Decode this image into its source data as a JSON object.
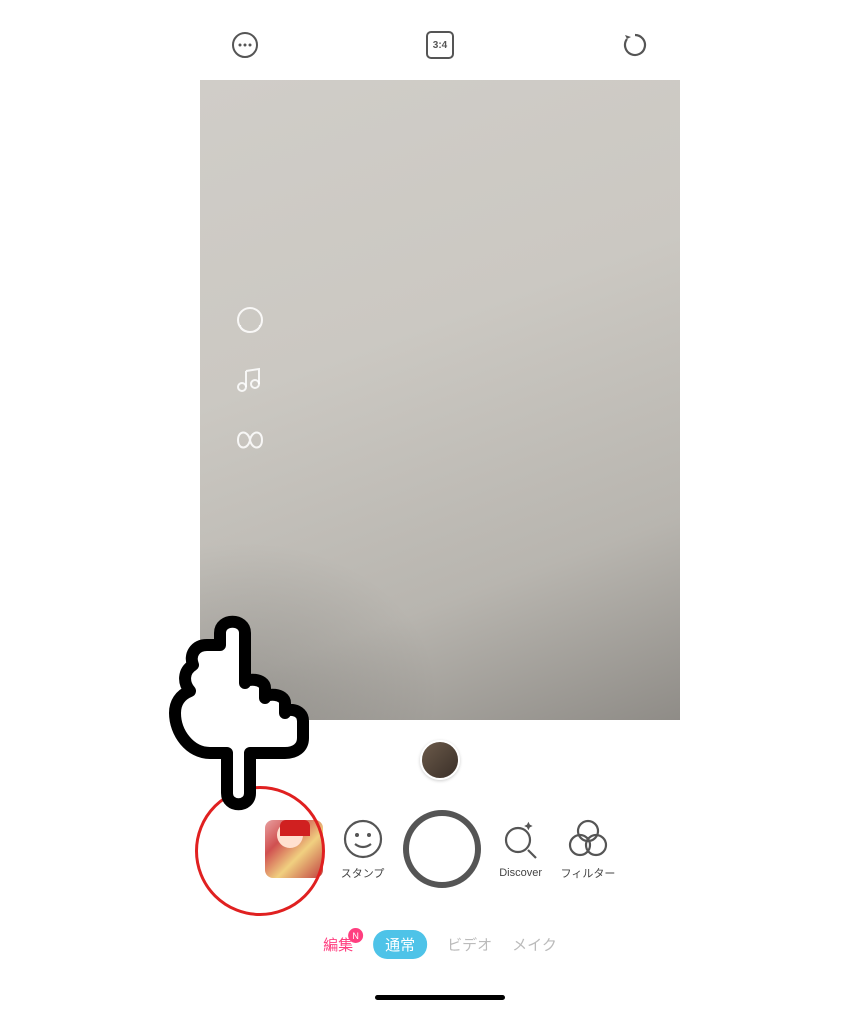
{
  "top": {
    "aspect_ratio": "3:4"
  },
  "side_tools": {
    "face": "face-icon",
    "music": "music-icon",
    "boomerang": "boomerang-icon"
  },
  "controls": {
    "stamp_label": "スタンプ",
    "discover_label": "Discover",
    "filter_label": "フィルター"
  },
  "modes": {
    "edit": "編集",
    "edit_badge": "N",
    "normal": "通常",
    "video": "ビデオ",
    "makeup": "メイク"
  }
}
